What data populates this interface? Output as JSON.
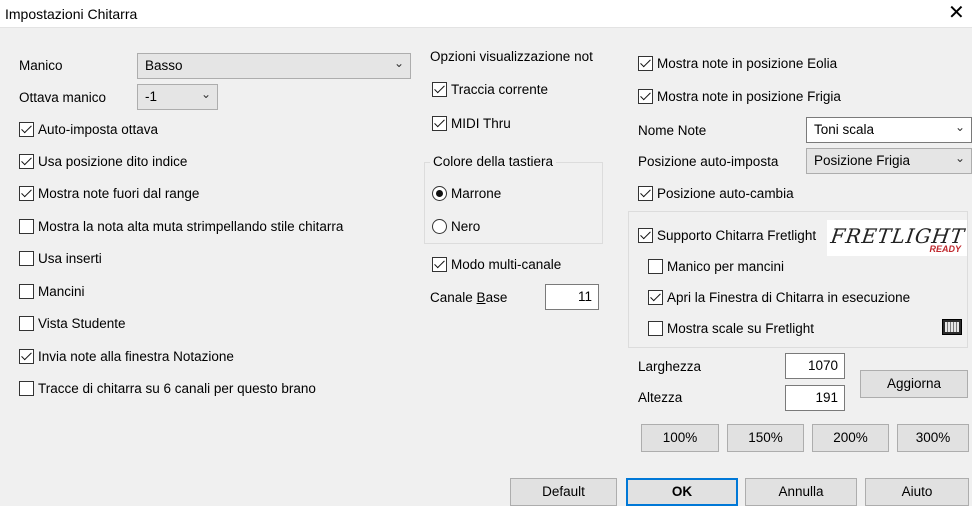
{
  "window": {
    "title": "Impostazioni Chitarra",
    "close_glyph": "✕"
  },
  "left": {
    "manico_label": "Manico",
    "manico_value": "Basso",
    "ottava_label": "Ottava manico",
    "ottava_value": "-1",
    "checkboxes": [
      {
        "label": "Auto-imposta ottava",
        "checked": true
      },
      {
        "label": "Usa posizione dito indice",
        "checked": true
      },
      {
        "label": "Mostra note fuori dal range",
        "checked": true
      },
      {
        "label": "Mostra la nota alta muta strimpellando stile chitarra",
        "checked": false
      },
      {
        "label": "Usa inserti",
        "checked": false
      },
      {
        "label": "Mancini",
        "checked": false
      },
      {
        "label": "Vista Studente",
        "checked": false
      },
      {
        "label": "Invia note alla finestra Notazione",
        "checked": true
      },
      {
        "label": "Tracce di chitarra su 6 canali per questo brano",
        "checked": false
      }
    ]
  },
  "middle": {
    "opzioni_title": "Opzioni visualizzazione not",
    "traccia_corrente": {
      "label": "Traccia corrente",
      "checked": true
    },
    "midi_thru": {
      "label": "MIDI Thru",
      "checked": true
    },
    "colore_title": "Colore della tastiera",
    "marrone": {
      "label": "Marrone",
      "checked": true
    },
    "nero": {
      "label": "Nero",
      "checked": false
    },
    "multicanale": {
      "label": "Modo multi-canale",
      "checked": true
    },
    "canale_base_pre": "Canale ",
    "canale_base_u": "B",
    "canale_base_post": "ase",
    "canale_base_value": "11"
  },
  "right": {
    "eolia": {
      "label": "Mostra note in posizione Eolia",
      "checked": true
    },
    "frigia": {
      "label": "Mostra note in posizione Frigia",
      "checked": true
    },
    "nome_note_label": "Nome Note",
    "nome_note_value": "Toni scala",
    "posizione_label": "Posizione auto-imposta",
    "posizione_value": "Posizione Frigia",
    "auto_cambia": {
      "label": "Posizione auto-cambia",
      "checked": true
    },
    "fretlight": {
      "label": "Supporto Chitarra Fretlight",
      "checked": true
    },
    "fretlight_logo_text": "FRETLIGHT",
    "fretlight_logo_ready": "READY",
    "manico_mancini": {
      "label": "Manico per mancini",
      "checked": false
    },
    "apri_finestra": {
      "label": "Apri la Finestra di Chitarra in esecuzione",
      "checked": true
    },
    "mostra_scale": {
      "label": "Mostra scale su Fretlight",
      "checked": false
    },
    "larghezza_label": "Larghezza",
    "larghezza_value": "1070",
    "altezza_label": "Altezza",
    "altezza_value": "191",
    "aggiorna_label": "Aggiorna",
    "zoom_buttons": [
      "100%",
      "150%",
      "200%",
      "300%"
    ]
  },
  "footer": {
    "default_label": "Default",
    "ok_label": "OK",
    "annulla_label": "Annulla",
    "aiuto_label": "Aiuto"
  },
  "icons": {
    "chevron": "⌄"
  }
}
